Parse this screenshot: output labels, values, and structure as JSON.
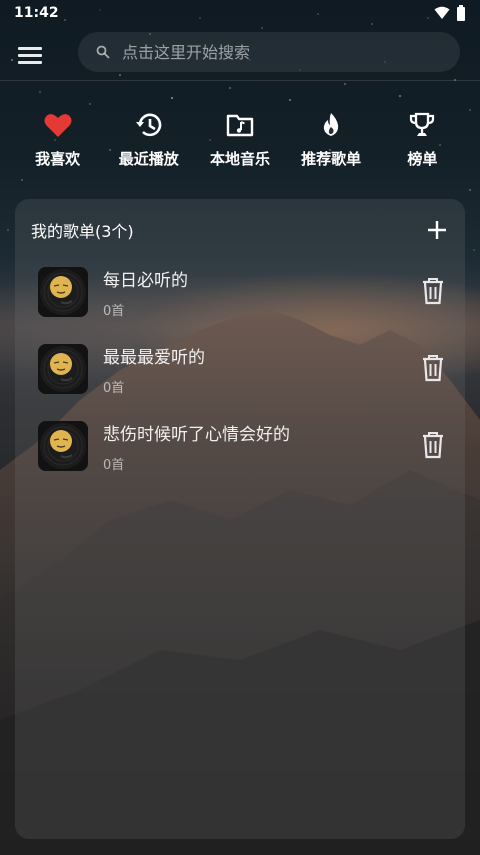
{
  "status": {
    "time": "11:42"
  },
  "search": {
    "placeholder": "点击这里开始搜索"
  },
  "quicknav": [
    {
      "label": "我喜欢",
      "icon": "heart-icon",
      "color": "#e53935"
    },
    {
      "label": "最近播放",
      "icon": "history-icon"
    },
    {
      "label": "本地音乐",
      "icon": "music-folder-icon"
    },
    {
      "label": "推荐歌单",
      "icon": "fire-icon"
    },
    {
      "label": "榜单",
      "icon": "trophy-icon"
    }
  ],
  "playlists": {
    "title": "我的歌单(3个)",
    "items": [
      {
        "name": "每日必听的",
        "count": "0首"
      },
      {
        "name": "最最最爱听的",
        "count": "0首"
      },
      {
        "name": "悲伤时候听了心情会好的",
        "count": "0首"
      }
    ]
  },
  "colors": {
    "accent_heart": "#e53935",
    "text": "#ffffff"
  }
}
